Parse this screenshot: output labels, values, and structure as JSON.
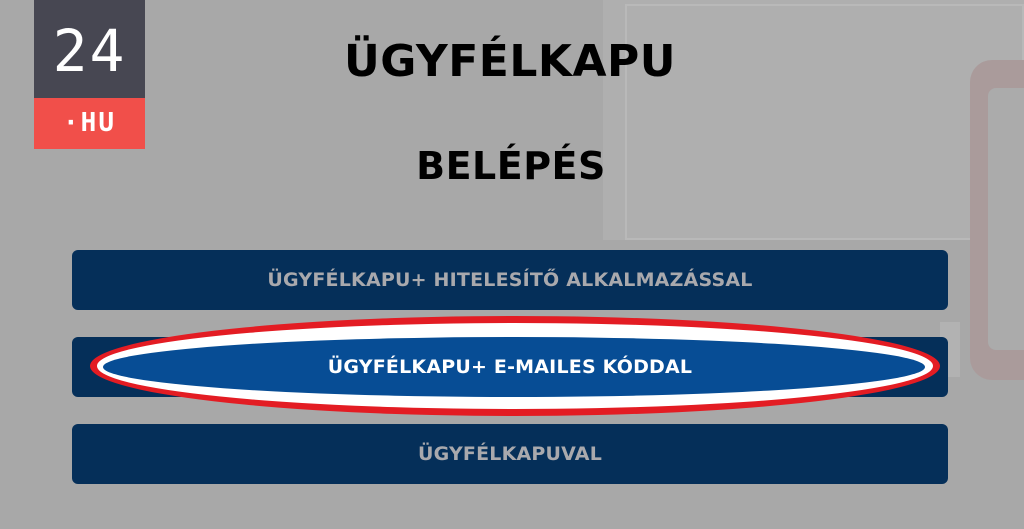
{
  "logo": {
    "top_text": "24",
    "bottom_text": "·HU",
    "top_color": "#474752",
    "bottom_color": "#f14f4a"
  },
  "page": {
    "title": "ÜGYFÉLKAPU",
    "subtitle": "BELÉPÉS"
  },
  "login_options": [
    {
      "label": "ÜGYFÉLKAPU+ HITELESÍTŐ ALKALMAZÁSSAL",
      "highlighted": false
    },
    {
      "label": "ÜGYFÉLKAPU+ E-MAILES KÓDDAL",
      "highlighted": true
    },
    {
      "label": "ÜGYFÉLKAPUVAL",
      "highlighted": false
    }
  ],
  "colors": {
    "button_background": "#052f59",
    "highlighted_button_background": "#074d95",
    "highlight_ring": "#e31c23",
    "page_background": "#a8a8a8"
  }
}
